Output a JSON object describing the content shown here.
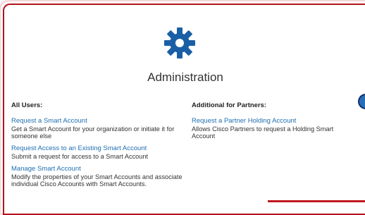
{
  "header": {
    "icon": "gear-icon",
    "title": "Administration"
  },
  "all_users": {
    "heading": "All Users:",
    "items": [
      {
        "label": "Request a Smart Account",
        "description": "Get a Smart Account for your organization or initiate it for someone else"
      },
      {
        "label": "Request Access to an Existing Smart Account",
        "description": "Submit a request for access to a Smart Account"
      },
      {
        "label": "Manage Smart Account",
        "description": "Modify the properties of your Smart Accounts and associate individual Cisco Accounts with Smart Accounts."
      }
    ]
  },
  "partners": {
    "heading": "Additional for Partners:",
    "items": [
      {
        "label": "Request a Partner Holding Account",
        "description": "Allows Cisco Partners to request a Holding Smart Account"
      }
    ]
  },
  "colors": {
    "accent": "#1f6fb3",
    "frame": "#b4121c",
    "gear": "#1a5fa6"
  }
}
